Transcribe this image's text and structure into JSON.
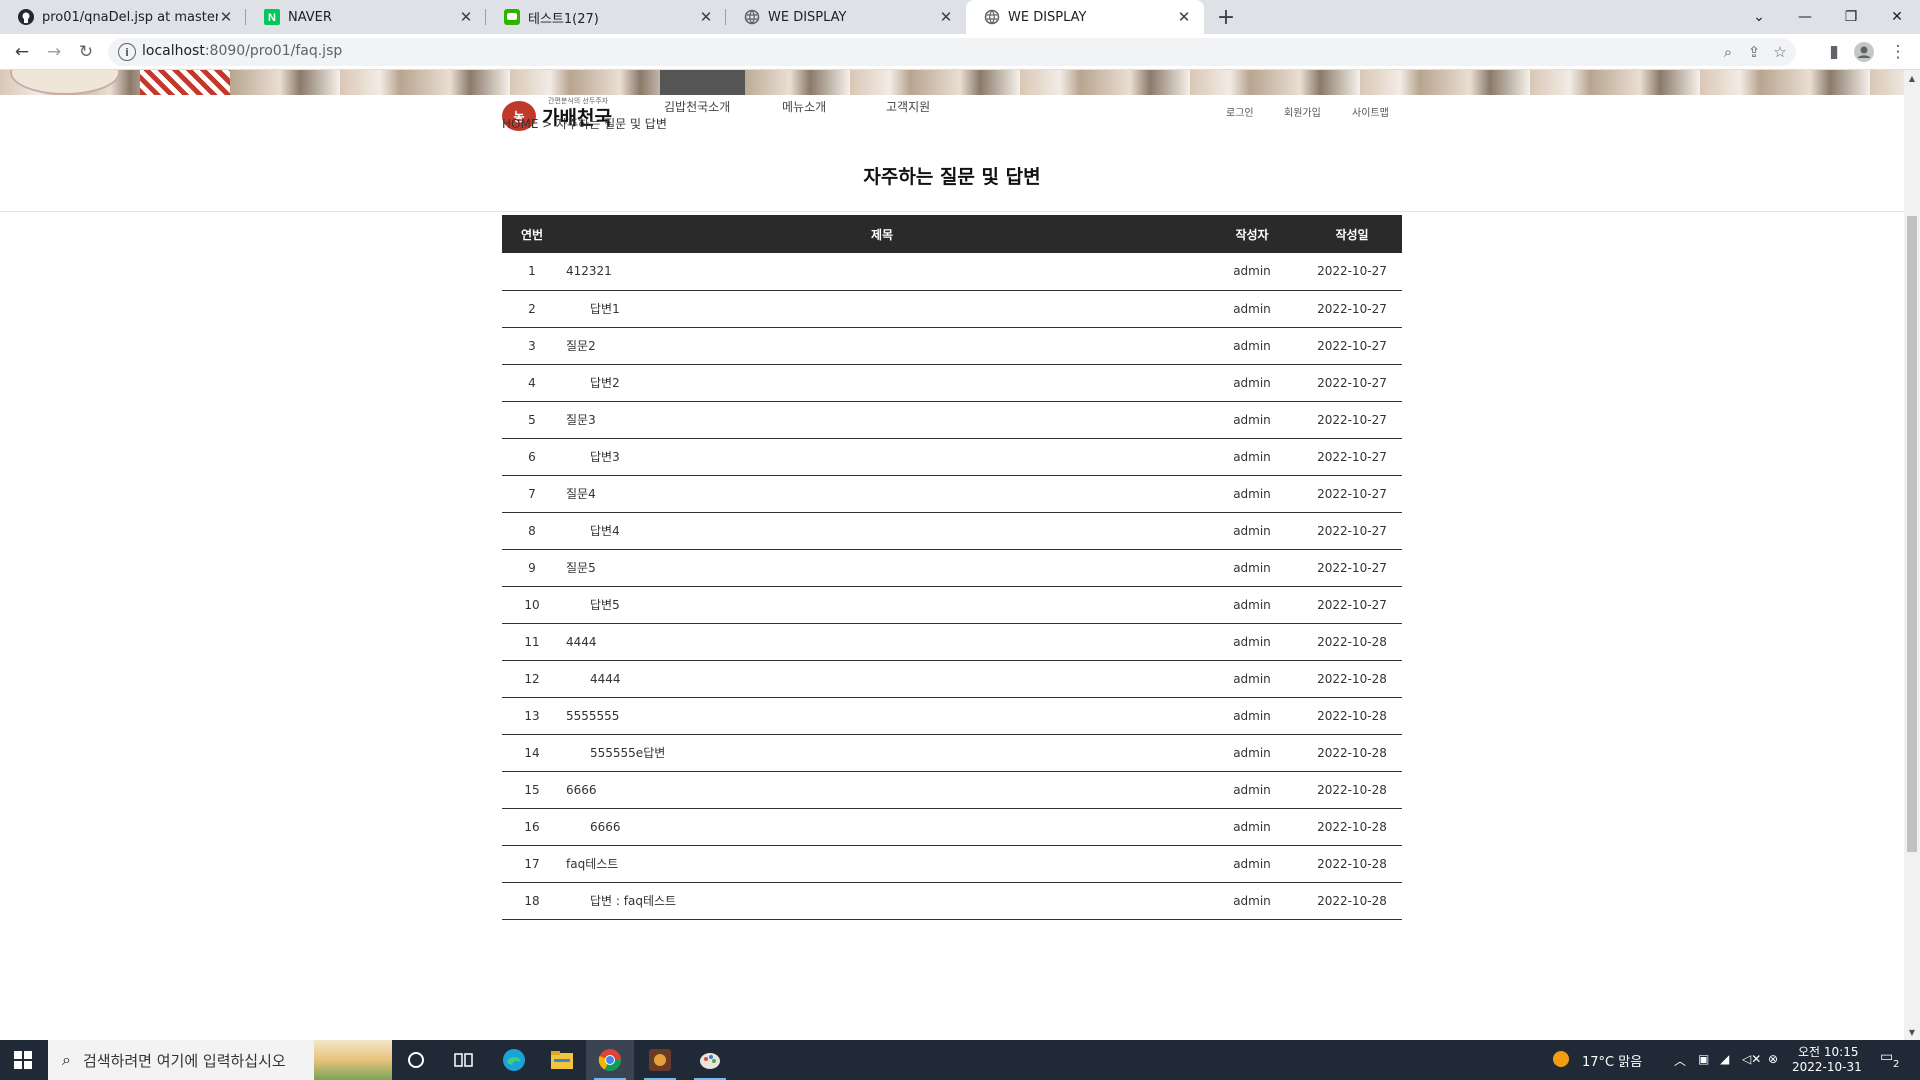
{
  "browser": {
    "tabs": [
      {
        "title": "pro01/qnaDel.jsp at master · ok",
        "icon": "github-icon"
      },
      {
        "title": "NAVER",
        "icon": "naver-icon"
      },
      {
        "title": "테스트1(27)",
        "icon": "chat-icon"
      },
      {
        "title": "WE DISPLAY",
        "icon": "globe-icon"
      },
      {
        "title": "WE DISPLAY",
        "icon": "globe-icon"
      }
    ],
    "url_host": "localhost",
    "url_rest": ":8090/pro01/faq.jsp"
  },
  "site": {
    "logo_mark": "농",
    "logo_text": "가배천국",
    "logo_sub": "간편분식의 선두주자",
    "nav": [
      "김밥천국소개",
      "메뉴소개",
      "고객지원"
    ],
    "util": [
      "로그인",
      "회원가입",
      "사이트맵"
    ],
    "breadcrumb": "HOME > 자주하는 질문 및 답변"
  },
  "page": {
    "title": "자주하는 질문 및 답변",
    "columns": {
      "no": "연번",
      "title": "제목",
      "writer": "작성자",
      "date": "작성일"
    },
    "rows": [
      {
        "no": "1",
        "title": "412321",
        "writer": "admin",
        "date": "2022-10-27"
      },
      {
        "no": "2",
        "title": "답변1",
        "writer": "admin",
        "date": "2022-10-27"
      },
      {
        "no": "3",
        "title": "질문2",
        "writer": "admin",
        "date": "2022-10-27"
      },
      {
        "no": "4",
        "title": "답변2",
        "writer": "admin",
        "date": "2022-10-27"
      },
      {
        "no": "5",
        "title": "질문3",
        "writer": "admin",
        "date": "2022-10-27"
      },
      {
        "no": "6",
        "title": "답변3",
        "writer": "admin",
        "date": "2022-10-27"
      },
      {
        "no": "7",
        "title": "질문4",
        "writer": "admin",
        "date": "2022-10-27"
      },
      {
        "no": "8",
        "title": "답변4",
        "writer": "admin",
        "date": "2022-10-27"
      },
      {
        "no": "9",
        "title": "질문5",
        "writer": "admin",
        "date": "2022-10-27"
      },
      {
        "no": "10",
        "title": "답변5",
        "writer": "admin",
        "date": "2022-10-27"
      },
      {
        "no": "11",
        "title": "4444",
        "writer": "admin",
        "date": "2022-10-28"
      },
      {
        "no": "12",
        "title": "4444",
        "writer": "admin",
        "date": "2022-10-28"
      },
      {
        "no": "13",
        "title": "5555555",
        "writer": "admin",
        "date": "2022-10-28"
      },
      {
        "no": "14",
        "title": "555555e답변",
        "writer": "admin",
        "date": "2022-10-28"
      },
      {
        "no": "15",
        "title": "6666",
        "writer": "admin",
        "date": "2022-10-28"
      },
      {
        "no": "16",
        "title": "6666",
        "writer": "admin",
        "date": "2022-10-28"
      },
      {
        "no": "17",
        "title": "faq테스트",
        "writer": "admin",
        "date": "2022-10-28"
      },
      {
        "no": "18",
        "title": "답변 : faq테스트",
        "writer": "admin",
        "date": "2022-10-28"
      }
    ]
  },
  "taskbar": {
    "search_placeholder": "검색하려면 여기에 입력하십시오",
    "apps": [
      "cortana-icon",
      "task-view-icon",
      "edge-icon",
      "file-explorer-icon",
      "chrome-icon",
      "game-app-icon",
      "paint-app-icon"
    ],
    "weather": "17°C  맑음",
    "time": "오전 10:15",
    "date": "2022-10-31",
    "notifications": "2"
  },
  "colors": {
    "table_header_bg": "#2a2a2a",
    "brand_red": "#c0392b",
    "taskbar_bg": "#202a37"
  }
}
